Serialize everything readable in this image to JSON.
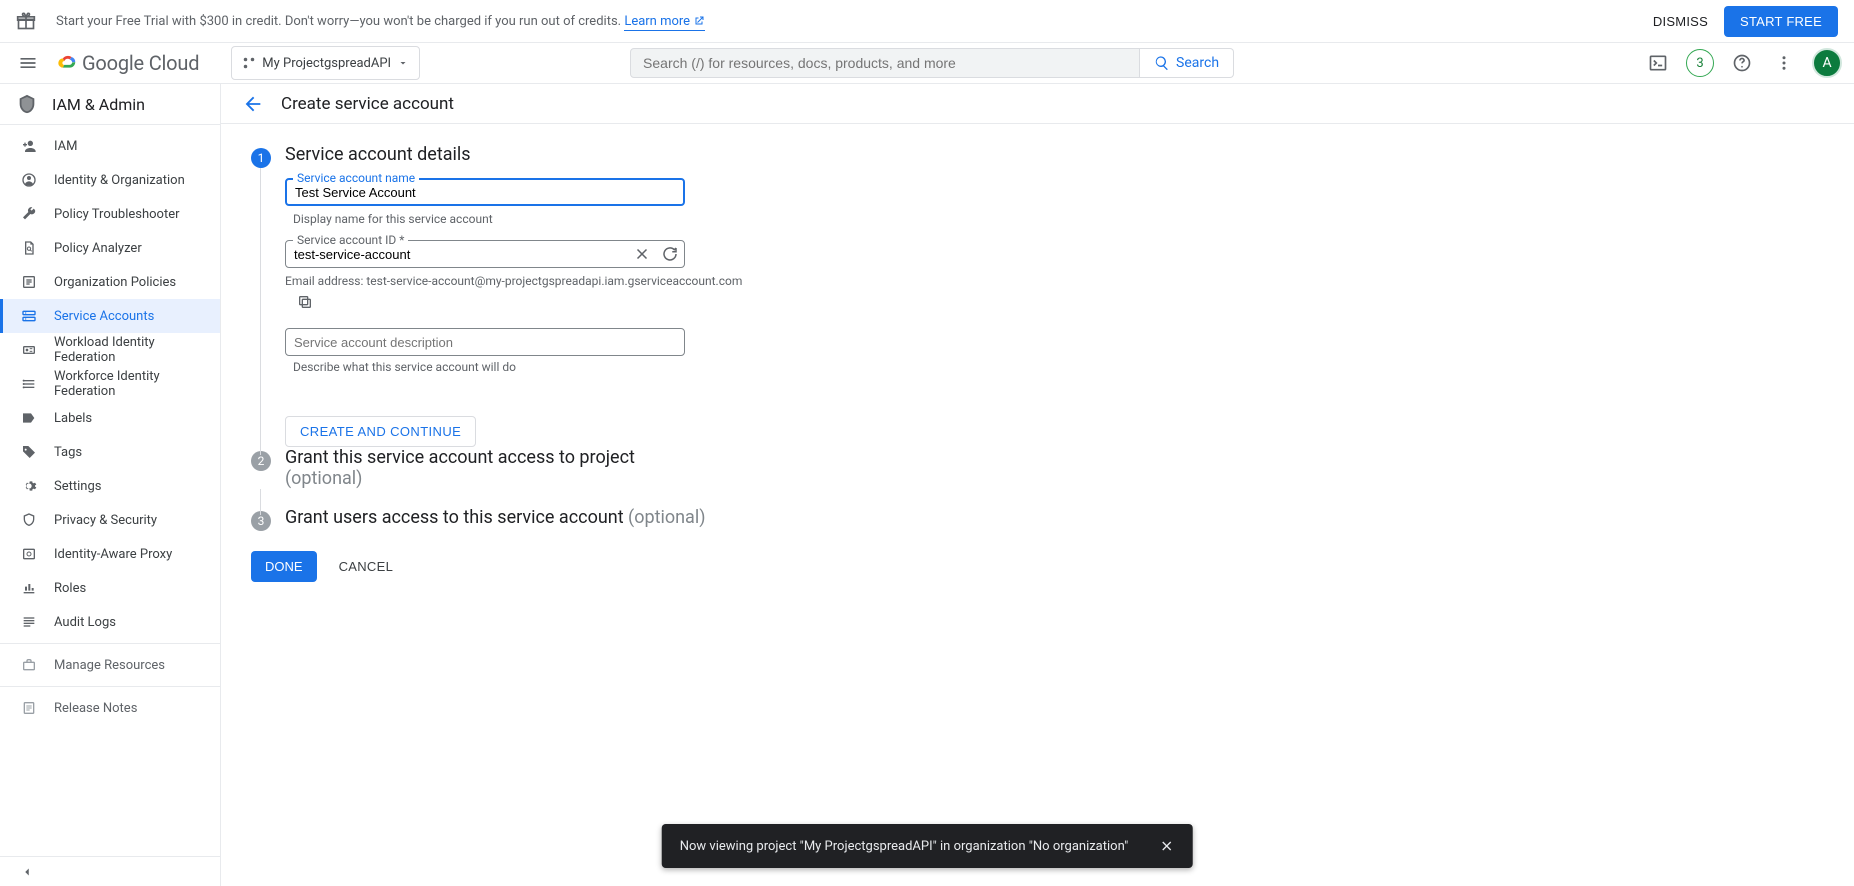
{
  "promo": {
    "text_prefix": "Start your Free Trial with $300 in credit. Don't worry—you won't be charged if you run out of credits. ",
    "link_text": "Learn more",
    "dismiss": "DISMISS",
    "start_free": "START FREE"
  },
  "header": {
    "logo_text": "Google Cloud",
    "project_name": "My ProjectgspreadAPI",
    "search_placeholder": "Search (/) for resources, docs, products, and more",
    "search_label": "Search",
    "trial_badge": "3",
    "avatar_letter": "A"
  },
  "sidebar": {
    "section_title": "IAM & Admin",
    "items": [
      {
        "label": "IAM"
      },
      {
        "label": "Identity & Organization"
      },
      {
        "label": "Policy Troubleshooter"
      },
      {
        "label": "Policy Analyzer"
      },
      {
        "label": "Organization Policies"
      },
      {
        "label": "Service Accounts"
      },
      {
        "label": "Workload Identity Federation"
      },
      {
        "label": "Workforce Identity Federation"
      },
      {
        "label": "Labels"
      },
      {
        "label": "Tags"
      },
      {
        "label": "Settings"
      },
      {
        "label": "Privacy & Security"
      },
      {
        "label": "Identity-Aware Proxy"
      },
      {
        "label": "Roles"
      },
      {
        "label": "Audit Logs"
      }
    ],
    "secondary": [
      {
        "label": "Manage Resources"
      },
      {
        "label": "Release Notes"
      }
    ]
  },
  "page": {
    "title": "Create service account"
  },
  "step1": {
    "title": "Service account details",
    "name_label": "Service account name",
    "name_value": "Test Service Account",
    "name_helper": "Display name for this service account",
    "id_label": "Service account ID *",
    "id_value": "test-service-account",
    "email_line": "Email address: test-service-account@my-projectgspreadapi.iam.gserviceaccount.com",
    "desc_placeholder": "Service account description",
    "desc_helper": "Describe what this service account will do",
    "create_continue": "CREATE AND CONTINUE"
  },
  "step2": {
    "title": "Grant this service account access to project",
    "optional": "(optional)"
  },
  "step3": {
    "title": "Grant users access to this service account ",
    "optional": "(optional)"
  },
  "actions": {
    "done": "DONE",
    "cancel": "CANCEL"
  },
  "toast": {
    "text": "Now viewing project \"My ProjectgspreadAPI\" in organization \"No organization\""
  }
}
